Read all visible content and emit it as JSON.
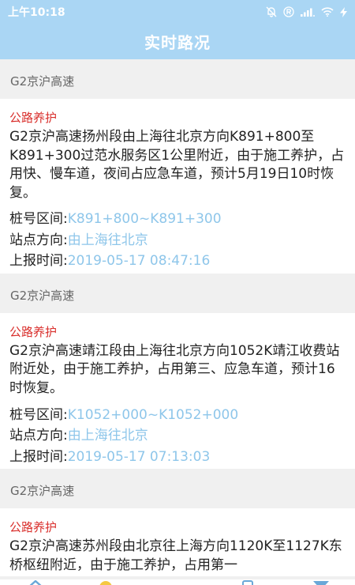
{
  "status_bar": {
    "time": "上午10:18",
    "icons": [
      "bell-off-icon",
      "r-circle-icon",
      "signal-icon",
      "wifi-icon",
      "bolt-icon"
    ]
  },
  "app": {
    "title": "实时路况"
  },
  "colors": {
    "app_bar": "#aad6f4",
    "tag": "#d9302d",
    "meta_value": "#8ec6ea",
    "section_bg": "#f0f0f0"
  },
  "labels": {
    "stake_range": "桩号区间:",
    "direction": "站点方向:",
    "report_time": "上报时间:"
  },
  "incidents": [
    {
      "road": "G2京沪高速",
      "tag": "公路养护",
      "description": "G2京沪高速扬州段由上海往北京方向K891+800至K891+300过范水服务区1公里附近，由于施工养护，占用快、慢车道，夜间占应急车道，预计5月19日10时恢复。",
      "stake_range": "K891+800~K891+300",
      "direction": "由上海往北京",
      "report_time": "2019-05-17 08:47:16"
    },
    {
      "road": "G2京沪高速",
      "tag": "公路养护",
      "description": "G2京沪高速靖江段由上海往北京方向1052K靖江收费站附近处，由于施工养护，占用第三、应急车道，预计16时恢复。",
      "stake_range": "K1052+000~K1052+000",
      "direction": "由上海往北京",
      "report_time": "2019-05-17 07:13:03"
    },
    {
      "road": "G2京沪高速",
      "tag": "公路养护",
      "description": "G2京沪高速苏州段由北京往上海方向1120K至1127K东桥枢纽附近，由于施工养护，占用第一"
    }
  ],
  "bottom_nav": {
    "icons": [
      "home-icon",
      "bulb-icon",
      "phone-icon",
      "send-icon"
    ]
  }
}
